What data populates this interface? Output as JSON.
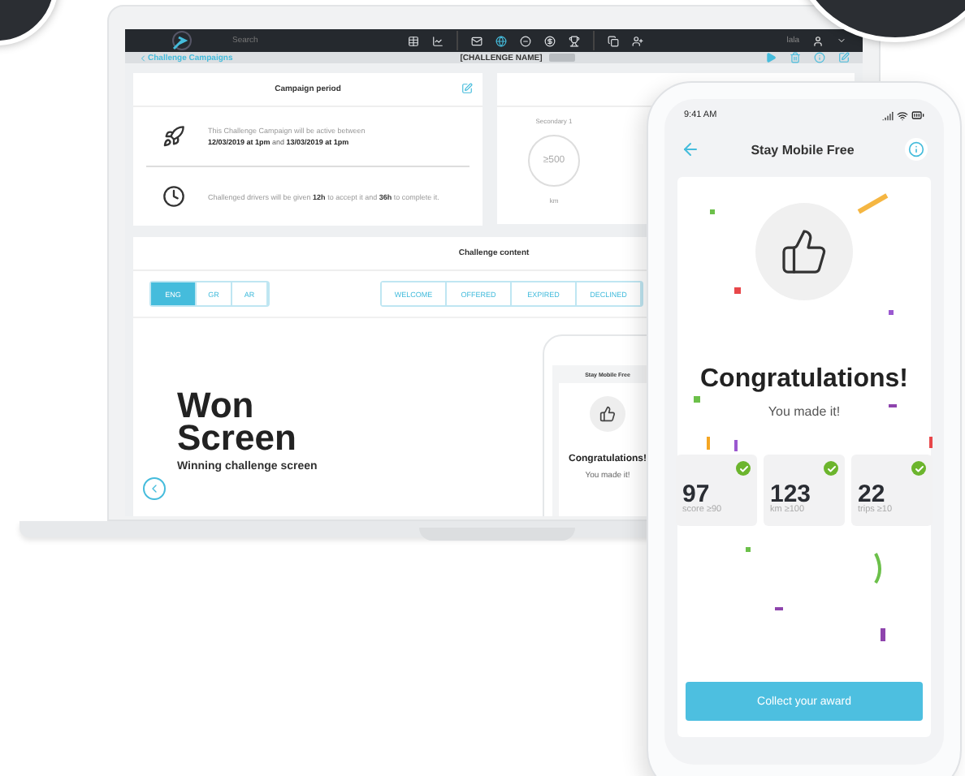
{
  "laptop": {
    "topbar": {
      "search_placeholder": "Search",
      "user": "lala",
      "nav_icons": [
        {
          "selected": false
        },
        {
          "selected": false
        },
        {
          "selected": false
        },
        {
          "selected": true
        },
        {
          "selected": false
        },
        {
          "selected": false
        },
        {
          "selected": false
        },
        {
          "selected": false
        },
        {
          "selected": false
        }
      ]
    },
    "subbar": {
      "back": "Challenge Campaigns",
      "title": "[CHALLENGE NAME]"
    },
    "campaign_period": {
      "title": "Campaign period",
      "active_intro": "This Challenge Campaign will be active between",
      "active_dates": "**12/03/2019 at 1pm** and **13/03/2019 at 1pm**",
      "timing": "Challenged drivers will be given **12h** to accept it and **36h** to complete it."
    },
    "secondary": {
      "label": "Secondary 1",
      "value": "≥500",
      "unit": "km"
    },
    "challenge_content": {
      "title": "Challenge content",
      "languages": [
        {
          "label": "ENG",
          "selected": true
        },
        {
          "label": "GR",
          "selected": false
        },
        {
          "label": "AR",
          "selected": false
        }
      ],
      "screens": [
        {
          "label": "WELCOME",
          "selected": false
        },
        {
          "label": "OFFERED",
          "selected": false
        },
        {
          "label": "EXPIRED",
          "selected": false
        },
        {
          "label": "DECLINED",
          "selected": false
        }
      ],
      "preview_title": "Won Screen",
      "preview_subtitle": "Winning challenge screen",
      "mini_phone": {
        "title": "Stay Mobile Free",
        "heading": "Congratulations!",
        "message": "You made it!"
      }
    }
  },
  "phone": {
    "time": "9:41 AM",
    "title": "Stay Mobile Free",
    "heading": "Congratulations!",
    "message": "You made it!",
    "stats": [
      {
        "value": "97",
        "label": "score ≥90",
        "done": true
      },
      {
        "value": "123",
        "label": "km ≥100",
        "done": true
      },
      {
        "value": "22",
        "label": "trips ≥10",
        "done": true
      }
    ],
    "button": "Collect your award"
  }
}
